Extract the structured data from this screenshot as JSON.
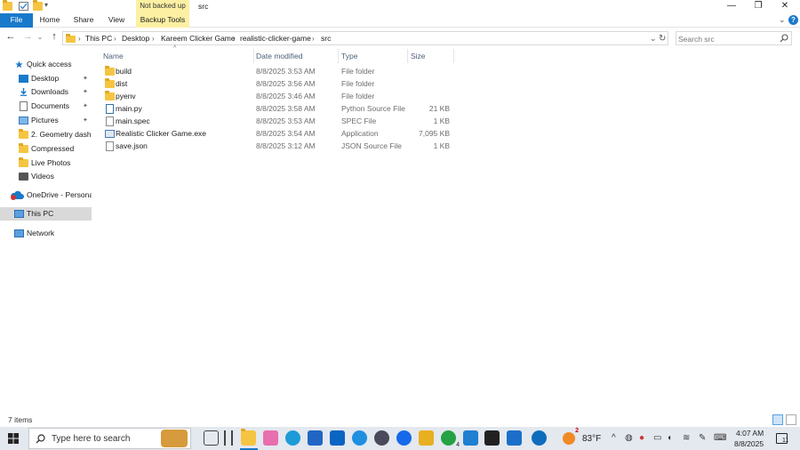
{
  "window": {
    "title": "src",
    "context_tab_title": "Not backed up",
    "minimize": "—",
    "restore": "❐",
    "close": "✕"
  },
  "ribbon": {
    "tabs": [
      "File",
      "Home",
      "Share",
      "View",
      "Backup Tools"
    ],
    "collapse": "⌄",
    "help": "?"
  },
  "nav": {
    "back": "←",
    "forward": "→",
    "recent": "⌄",
    "up": "↑",
    "breadcrumbs": [
      "This PC",
      "Desktop",
      "Kareem Clicker Game",
      "realistic-clicker-game",
      "src"
    ],
    "separator": "›",
    "dropdown": "⌄",
    "refresh": "↻",
    "search_placeholder": "Search src"
  },
  "sidebar": {
    "items": [
      {
        "label": "Quick access",
        "icon": "star-icon",
        "pinned": false
      },
      {
        "label": "Desktop",
        "icon": "desktop-icon",
        "pinned": true
      },
      {
        "label": "Downloads",
        "icon": "download-icon",
        "pinned": true
      },
      {
        "label": "Documents",
        "icon": "document-icon",
        "pinned": true
      },
      {
        "label": "Pictures",
        "icon": "picture-icon",
        "pinned": true
      },
      {
        "label": "2. Geometry dash b",
        "icon": "folder-icon",
        "pinned": false
      },
      {
        "label": "Compressed",
        "icon": "folder-icon",
        "pinned": false
      },
      {
        "label": "Live Photos",
        "icon": "folder-icon",
        "pinned": false
      },
      {
        "label": "Videos",
        "icon": "video-icon",
        "pinned": false
      },
      {
        "label": "OneDrive - Personal",
        "icon": "cloud-icon",
        "pinned": false
      },
      {
        "label": "This PC",
        "icon": "computer-icon",
        "pinned": false
      },
      {
        "label": "Network",
        "icon": "network-icon",
        "pinned": false
      }
    ],
    "pin_glyph": "📌"
  },
  "columns": {
    "name": "Name",
    "date": "Date modified",
    "type": "Type",
    "size": "Size",
    "sort_glyph": "^"
  },
  "files": [
    {
      "name": "build",
      "date": "8/8/2025 3:53 AM",
      "type": "File folder",
      "size": "",
      "icon": "folder-icon"
    },
    {
      "name": "dist",
      "date": "8/8/2025 3:56 AM",
      "type": "File folder",
      "size": "",
      "icon": "folder-icon"
    },
    {
      "name": "pyenv",
      "date": "8/8/2025 3:46 AM",
      "type": "File folder",
      "size": "",
      "icon": "folder-icon"
    },
    {
      "name": "main.py",
      "date": "8/8/2025 3:58 AM",
      "type": "Python Source File",
      "size": "21 KB",
      "icon": "python-file-icon"
    },
    {
      "name": "main.spec",
      "date": "8/8/2025 3:53 AM",
      "type": "SPEC File",
      "size": "1 KB",
      "icon": "file-icon"
    },
    {
      "name": "Realistic Clicker Game.exe",
      "date": "8/8/2025 3:54 AM",
      "type": "Application",
      "size": "7,095 KB",
      "icon": "exe-icon"
    },
    {
      "name": "save.json",
      "date": "8/8/2025 3:12 AM",
      "type": "JSON Source File",
      "size": "1 KB",
      "icon": "file-icon"
    }
  ],
  "status": {
    "item_count": "7 items"
  },
  "taskbar": {
    "search_placeholder": "Type here to search",
    "weather": "83°F",
    "weather_badge": "2",
    "chevron": "^",
    "whatsapp_badge": "4",
    "time": "4:07 AM",
    "date": "8/8/2025",
    "notifications": "11"
  },
  "colors": {
    "accent": "#1979ca",
    "folder": "#f5c542",
    "context_tab": "#fdf0a3",
    "selected": "#d9d9d9",
    "taskbar": "#e4e8ef"
  }
}
